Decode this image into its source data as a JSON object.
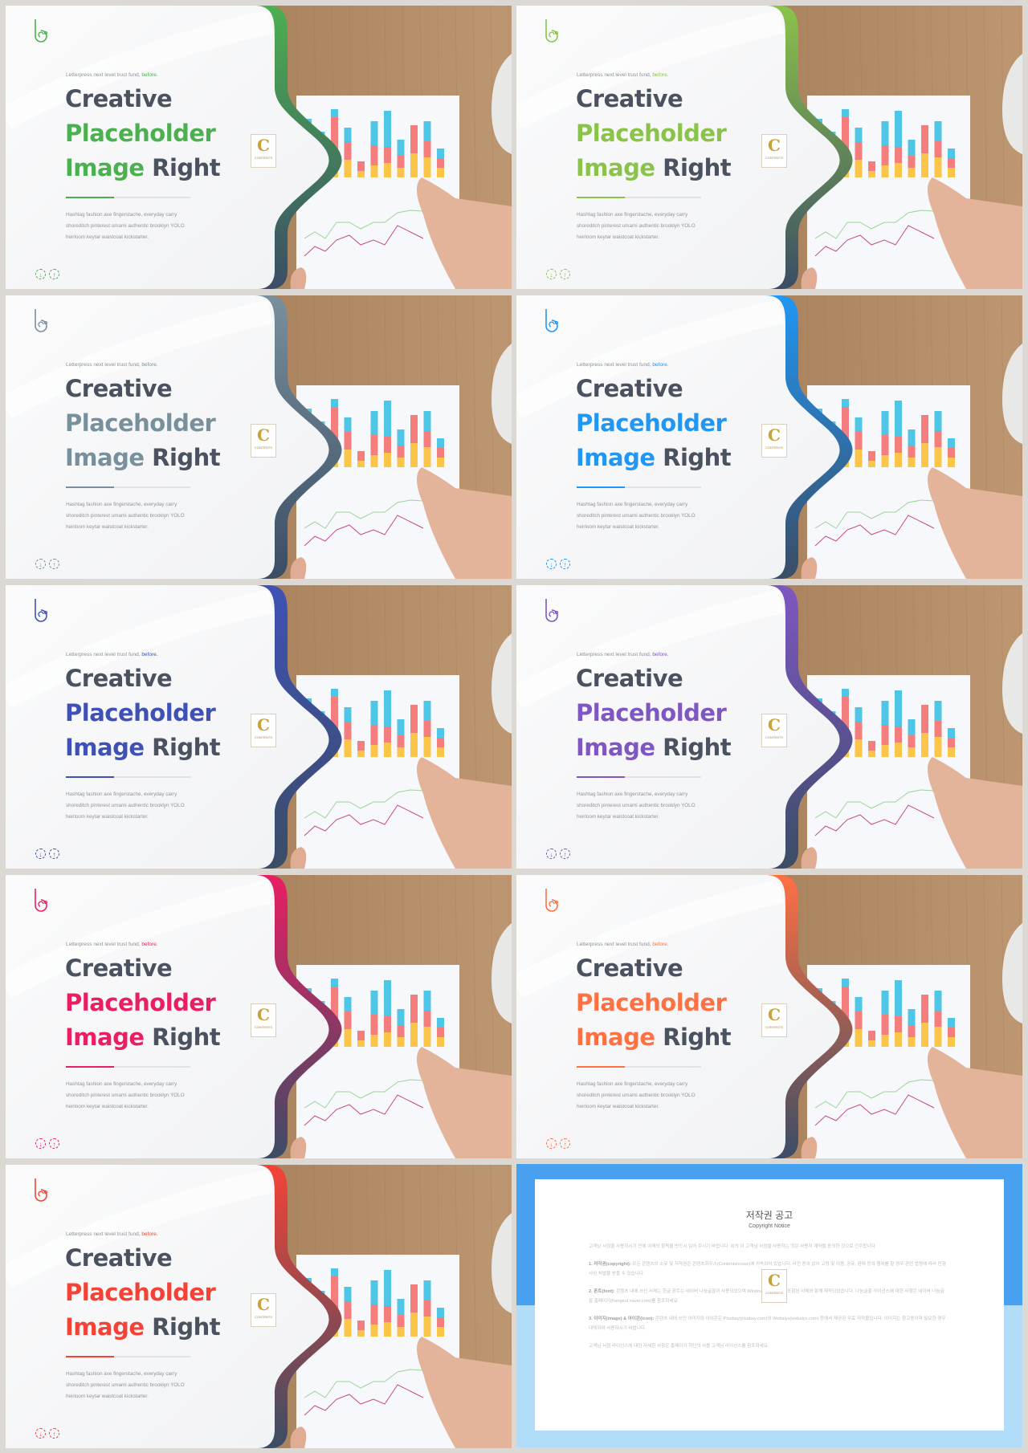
{
  "slide_common": {
    "tagline": "Letterpress next level trust fund,",
    "tagline_accent": "before.",
    "title_line1": "Creative",
    "title_line2": "Placeholder",
    "title_line3_a": "Image",
    "title_line3_b": "Right",
    "body_lines": [
      "Hashtag fashion axe fingerstache, everyday carry",
      "shoreditch pinterest umami authentic brooklyn YOLO",
      "heirloom  keytar waistcoat kickstarter."
    ],
    "stamp_letter": "C",
    "stamp_text": "CONTENTS",
    "prev_icon": "arrow-down-circle-icon",
    "next_icon": "arrow-up-circle-icon"
  },
  "slides": [
    {
      "accent": "#4caf50",
      "image_word_accent": true
    },
    {
      "accent": "#8bc34a",
      "image_word_accent": true
    },
    {
      "accent": "#78909c",
      "image_word_accent": true
    },
    {
      "accent": "#2196f3",
      "image_word_accent": true
    },
    {
      "accent": "#3f51b5",
      "image_word_accent": true
    },
    {
      "accent": "#7e57c2",
      "image_word_accent": true
    },
    {
      "accent": "#e91e63",
      "image_word_accent": true
    },
    {
      "accent": "#ff7043",
      "image_word_accent": true
    },
    {
      "accent": "#f44336",
      "image_word_accent": true
    }
  ],
  "copyright": {
    "title": "저작권 공고",
    "subtitle": "Copyright Notice",
    "intro": "고객님 서점을 사용하시기 전에 아래의 항목을 반드시 읽어 주시기 바랍니다. 위의 이 고객님 서점을 사용하는 것은 사용자 계약을 동의한 것으로 간주합니다.",
    "sections": [
      {
        "heading": "1. 저작권(copyright):",
        "text": "모든 콘텐츠의 소유 및 저작권은 콘텐츠하우스(Contentshouse)에 귀속되어 있습니다. 사전 동의 없이 고정 및 이용, 공유, 판매 등의 행위를 할 경우 관련 법령에 따라 민형사상 처벌을 받을 수 있습니다."
      },
      {
        "heading": "2. 폰트(font):",
        "text": "콘텐츠 내에 쓰인 서체는 한글 폰트는 네이버 나눔글꼴이 사용되었으며 Windows System에 포함된 서체와 함께 제작되었습니다. 나눔글꼴 라이선스에 대한 사항은 네이버 나눔글꼴 홈페이지(hangeul.naver.com)를 참조하세요."
      },
      {
        "heading": "3. 이미지(image) & 아이콘(icon):",
        "text": "콘텐츠 내에 쓰인 이미지와 아이콘은 Pixabay(pixabay.com)와 Webalys(webalys.com) 등에서 제공된 무료 저작물입니다. 이미지는 참고용이며 필요한 경우 대체하여 사용하시기 바랍니다."
      }
    ],
    "footer": "고객님 서점 라이선스에 대한 자세한 사항은 홈페이지 하단의 사용 고객님 라이선스를 참조하세요."
  }
}
